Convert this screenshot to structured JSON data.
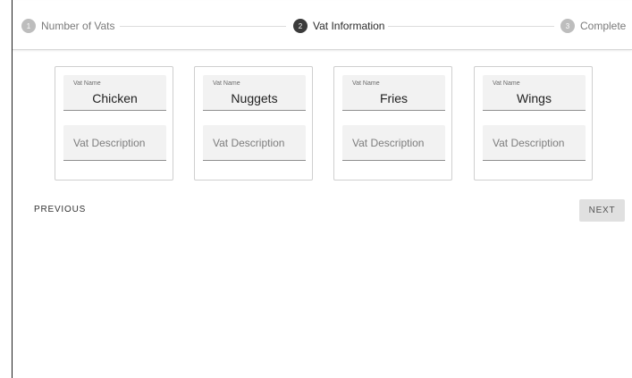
{
  "stepper": {
    "steps": [
      {
        "number": "1",
        "label": "Number of Vats",
        "state": "inactive"
      },
      {
        "number": "2",
        "label": "Vat Information",
        "state": "active"
      },
      {
        "number": "3",
        "label": "Complete",
        "state": "inactive"
      }
    ]
  },
  "vats": [
    {
      "name_label": "Vat Name",
      "name": "Chicken",
      "description_placeholder": "Vat Description"
    },
    {
      "name_label": "Vat Name",
      "name": "Nuggets",
      "description_placeholder": "Vat Description"
    },
    {
      "name_label": "Vat Name",
      "name": "Fries",
      "description_placeholder": "Vat Description"
    },
    {
      "name_label": "Vat Name",
      "name": "Wings",
      "description_placeholder": "Vat Description"
    }
  ],
  "actions": {
    "previous_label": "PREVIOUS",
    "next_label": "NEXT"
  },
  "colors": {
    "active_step": "#3b3b3b",
    "inactive_step": "#bdbdbd",
    "field_background": "#f2f2f2",
    "next_button": "#e0e0e0"
  }
}
